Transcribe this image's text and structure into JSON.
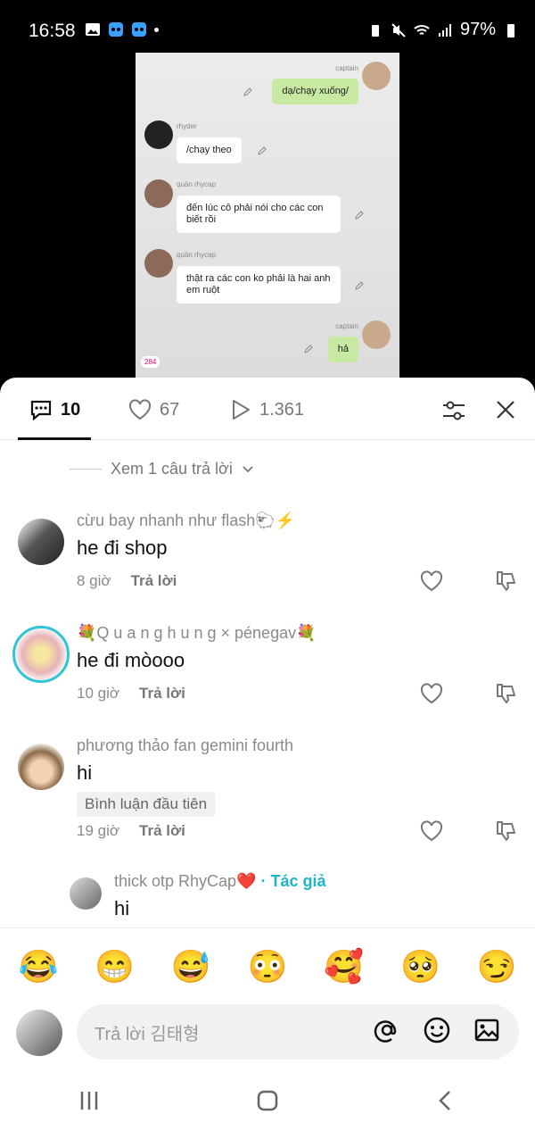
{
  "status_bar": {
    "time": "16:58",
    "battery": "97%"
  },
  "video": {
    "messages": [
      {
        "user": "captain",
        "text": "dạ/chạy xuống/",
        "side": "right"
      },
      {
        "user": "rhyder",
        "text": "/chạy theo",
        "side": "left"
      },
      {
        "user": "quản rhycap",
        "text": "đến lúc cô phải nói cho các con biết rồi",
        "side": "left"
      },
      {
        "user": "quản rhycap",
        "text": "thật ra các con ko phải là hai anh em ruột",
        "side": "left"
      },
      {
        "user": "captain",
        "text": "hả",
        "side": "right"
      }
    ],
    "counter": "284"
  },
  "tabs": {
    "comments": "10",
    "likes": "67",
    "views": "1.361"
  },
  "view_replies": "Xem 1 câu trả lời",
  "comments": [
    {
      "name": "cừu bay nhanh như flash🐑⚡",
      "text": "he đi shop",
      "time": "8 giờ",
      "reply": "Trả lời"
    },
    {
      "name": "💐Q u a n g h u n g × pénegav💐",
      "text": "he đi mòooo",
      "time": "10 giờ",
      "reply": "Trả lời"
    },
    {
      "name": "phương thảo fan gemini fourth",
      "text": "hi",
      "badge": "Bình luận đầu tiên",
      "time": "19 giờ",
      "reply": "Trả lời"
    }
  ],
  "reply": {
    "name": "thick otp RhyCap❤️",
    "author_label": "· Tác giả",
    "text": "hi"
  },
  "emojis": [
    "😂",
    "😁",
    "😅",
    "😳",
    "🥰",
    "🥺",
    "😏"
  ],
  "input": {
    "placeholder": "Trả lời 김태형"
  },
  "colors": {
    "accent": "#1fb5c9",
    "bubble_green": "#c7e9a2"
  }
}
